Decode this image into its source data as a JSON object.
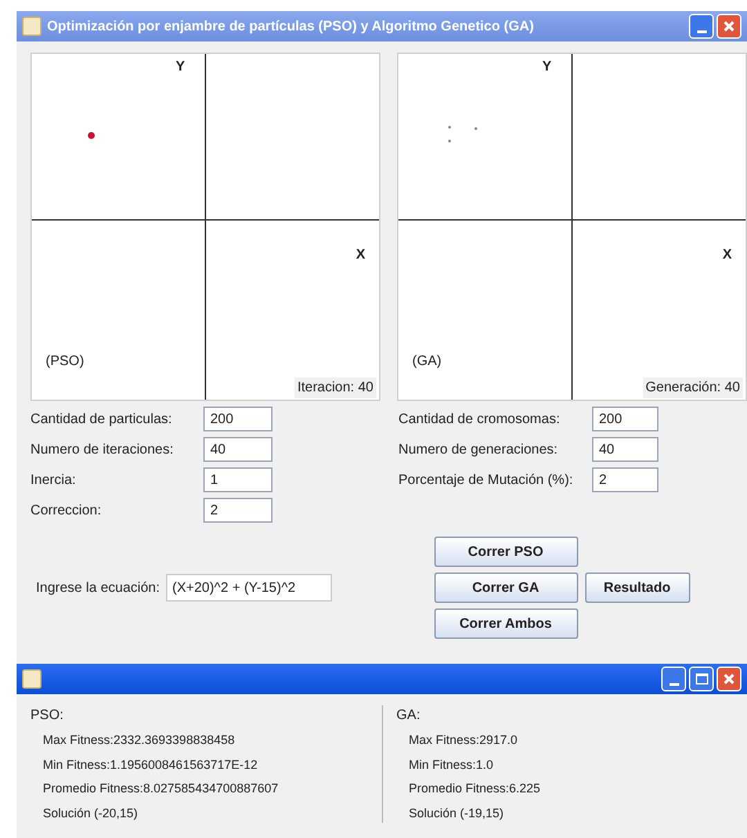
{
  "window": {
    "title": "Optimización por enjambre de partículas (PSO) y Algoritmo Genetico (GA)"
  },
  "plots": [
    {
      "axis_y": "Y",
      "axis_x": "X",
      "name": "(PSO)",
      "counter": "Iteracion: 40"
    },
    {
      "axis_y": "Y",
      "axis_x": "X",
      "name": "(GA)",
      "counter": "Generación: 40"
    }
  ],
  "pso_fields": [
    {
      "label": "Cantidad de particulas:",
      "value": "200"
    },
    {
      "label": "Numero de iteraciones:",
      "value": "40"
    },
    {
      "label": "Inercia:",
      "value": "1"
    },
    {
      "label": "Correccion:",
      "value": "2"
    }
  ],
  "ga_fields": [
    {
      "label": "Cantidad de cromosomas:",
      "value": "200"
    },
    {
      "label": "Numero de generaciones:",
      "value": "40"
    },
    {
      "label": "Porcentaje de Mutación (%):",
      "value": "2"
    }
  ],
  "equation": {
    "label": "Ingrese la ecuación:",
    "value": "(X+20)^2 + (Y-15)^2"
  },
  "buttons": {
    "run_pso": "Correr PSO",
    "run_ga": "Correr GA",
    "result": "Resultado",
    "run_both": "Correr Ambos"
  },
  "results": [
    {
      "title": "PSO:",
      "lines": [
        "Max Fitness:2332.3693398838458",
        "Min Fitness:1.1956008461563717E-12",
        "Promedio Fitness:8.027585434700887607",
        "Solución (-20,15)"
      ]
    },
    {
      "title": "GA:",
      "lines": [
        "Max Fitness:2917.0",
        "Min Fitness:1.0",
        "Promedio Fitness:6.225",
        "Solución (-19,15)"
      ]
    }
  ]
}
